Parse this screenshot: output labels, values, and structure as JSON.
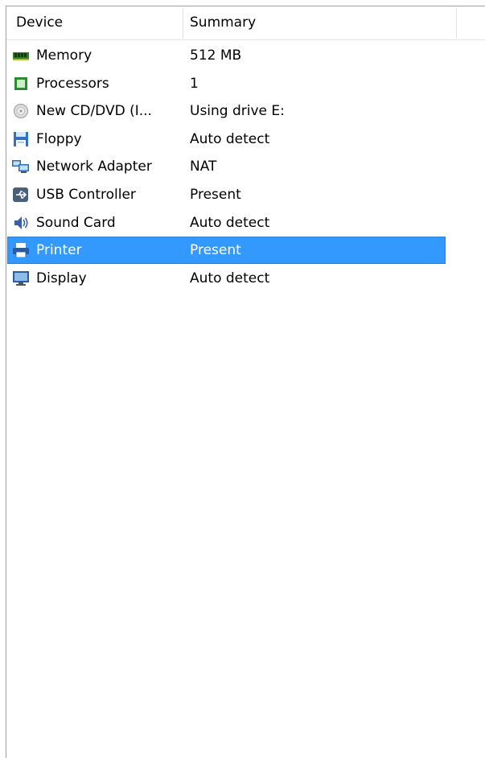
{
  "header": {
    "device_label": "Device",
    "summary_label": "Summary"
  },
  "selected_index": 7,
  "devices": [
    {
      "name": "Memory",
      "summary": "512 MB",
      "icon": "memory-icon"
    },
    {
      "name": "Processors",
      "summary": "1",
      "icon": "processor-icon"
    },
    {
      "name": "New CD/DVD (I...",
      "summary": "Using drive E:",
      "icon": "cd-dvd-icon"
    },
    {
      "name": "Floppy",
      "summary": "Auto detect",
      "icon": "floppy-icon"
    },
    {
      "name": "Network Adapter",
      "summary": "NAT",
      "icon": "network-adapter-icon"
    },
    {
      "name": "USB Controller",
      "summary": "Present",
      "icon": "usb-icon"
    },
    {
      "name": "Sound Card",
      "summary": "Auto detect",
      "icon": "sound-card-icon"
    },
    {
      "name": "Printer",
      "summary": "Present",
      "icon": "printer-icon"
    },
    {
      "name": "Display",
      "summary": "Auto detect",
      "icon": "display-icon"
    }
  ],
  "colors": {
    "selection": "#3399ff",
    "selection_text": "#ffffff"
  }
}
